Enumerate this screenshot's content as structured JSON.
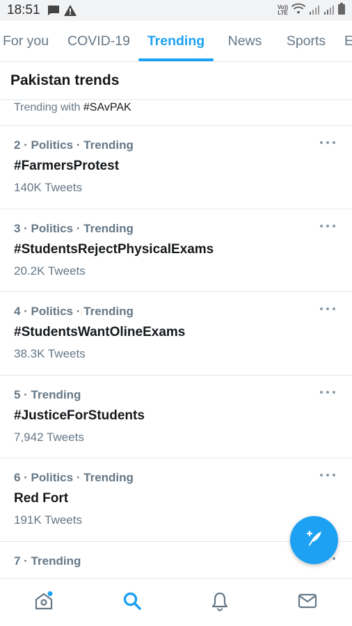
{
  "status_bar": {
    "time": "18:51",
    "network_label_top": "Vo))",
    "network_label_bottom": "LTE",
    "icons": [
      "message-icon",
      "warning-icon",
      "volte-icon",
      "wifi-icon",
      "signal-icon",
      "signal-icon",
      "battery-icon"
    ]
  },
  "tabs": [
    {
      "label": "For you",
      "active": false
    },
    {
      "label": "COVID-19",
      "active": false
    },
    {
      "label": "Trending",
      "active": true
    },
    {
      "label": "News",
      "active": false
    },
    {
      "label": "Sports",
      "active": false
    },
    {
      "label": "E",
      "active": false
    }
  ],
  "section": {
    "title": "Pakistan trends"
  },
  "partial_trend": {
    "prefix": "Trending with ",
    "hashtag": "#SAvPAK"
  },
  "trends": [
    {
      "meta": "2 · Politics · Trending",
      "name": "#FarmersProtest",
      "count": "140K Tweets"
    },
    {
      "meta": "3 · Politics · Trending",
      "name": "#StudentsRejectPhysicalExams",
      "count": "20.2K Tweets"
    },
    {
      "meta": "4 · Politics · Trending",
      "name": "#StudentsWantOlineExams",
      "count": "38.3K Tweets"
    },
    {
      "meta": "5 · Trending",
      "name": "#JusticeForStudents",
      "count": "7,942 Tweets"
    },
    {
      "meta": "6 · Politics · Trending",
      "name": "Red Fort",
      "count": "191K Tweets"
    },
    {
      "meta": "7 · Trending",
      "name": "",
      "count": ""
    }
  ],
  "fab": {
    "icon": "compose-tweet-icon"
  },
  "bottom_nav": [
    {
      "icon": "home-icon",
      "has_badge": true
    },
    {
      "icon": "search-icon",
      "active": true
    },
    {
      "icon": "notifications-bell-icon"
    },
    {
      "icon": "messages-envelope-icon"
    }
  ],
  "colors": {
    "accent": "#1da1f2",
    "secondary_text": "#657786",
    "primary_text": "#14171a",
    "divider": "#e1e8ed"
  }
}
